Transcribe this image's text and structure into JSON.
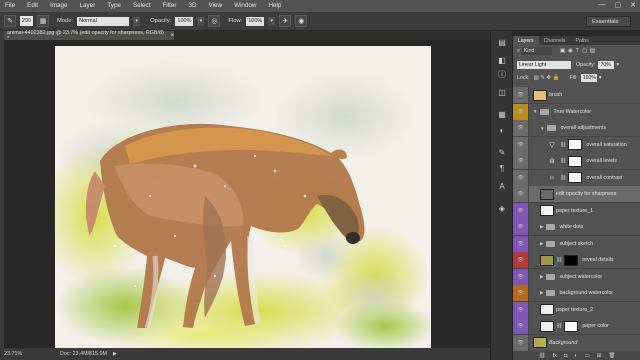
{
  "menu": [
    "File",
    "Edit",
    "Image",
    "Layer",
    "Type",
    "Select",
    "Filter",
    "3D",
    "View",
    "Window",
    "Help"
  ],
  "window_controls": [
    "—",
    "▢",
    "✕"
  ],
  "options": {
    "brush_size": "200",
    "mode_label": "Mode:",
    "mode_value": "Normal",
    "opacity_label": "Opacity:",
    "opacity_value": "100%",
    "flow_label": "Flow:",
    "flow_value": "100%",
    "workspace": "Essentials"
  },
  "document": {
    "tab_title": "animal-4402382.jpg @ 23.7% (edit opacity for sharpness, RGB/8) *",
    "close": "×"
  },
  "status": {
    "zoom": "23.71%",
    "doc_size": "Doc: 23.4M/815.9M"
  },
  "panel": {
    "tabs": [
      "Layers",
      "Channels",
      "Paths"
    ],
    "filter_label": "Kind",
    "blend_mode": "Linear Light",
    "opacity_label": "Opacity:",
    "opacity_value": "70%",
    "lock_label": "Lock:",
    "fill_label": "Fill:",
    "fill_value": "100%"
  },
  "layers": [
    {
      "name": "brush",
      "color": "#6b6b6b",
      "type": "pixel",
      "indent": 0
    },
    {
      "name": "True Watercolor",
      "color": "#b58e1e",
      "type": "group",
      "indent": 0
    },
    {
      "name": "overall adjustments",
      "color": "#6b6b6b",
      "type": "group",
      "indent": 1
    },
    {
      "name": "overall saturation",
      "color": "#6b6b6b",
      "type": "adjustment",
      "icon": "▽",
      "indent": 2
    },
    {
      "name": "overall levels",
      "color": "#6b6b6b",
      "type": "adjustment",
      "icon": "ılı",
      "indent": 2
    },
    {
      "name": "overall contrast",
      "color": "#6b6b6b",
      "type": "adjustment",
      "icon": "☼",
      "indent": 2
    },
    {
      "name": "edit opacity for sharpness",
      "color": "#6b6b6b",
      "type": "pixel",
      "indent": 1,
      "selected": true
    },
    {
      "name": "paper texture_1",
      "color": "#7f56b6",
      "type": "pixel",
      "indent": 1
    },
    {
      "name": "white dots",
      "color": "#7f56b6",
      "type": "group",
      "indent": 1
    },
    {
      "name": "subject sketch",
      "color": "#7f56b6",
      "type": "group",
      "indent": 1
    },
    {
      "name": "reveal details",
      "color": "#b13a3a",
      "type": "pixel",
      "indent": 1
    },
    {
      "name": "subject watercolor",
      "color": "#7f56b6",
      "type": "group",
      "indent": 1
    },
    {
      "name": "background watercolor",
      "color": "#b56a1e",
      "type": "group",
      "indent": 1
    },
    {
      "name": "paper texture_2",
      "color": "#7f56b6",
      "type": "pixel",
      "indent": 1
    },
    {
      "name": "paper color",
      "color": "#7f56b6",
      "type": "pixel",
      "indent": 1
    },
    {
      "name": "Background",
      "color": "#6b6b6b",
      "type": "background",
      "indent": 0
    }
  ],
  "panel_bottom_icons": [
    "link-icon",
    "fx-icon",
    "mask-icon",
    "adjustment-icon",
    "folder-icon",
    "new-layer-icon",
    "trash-icon"
  ]
}
